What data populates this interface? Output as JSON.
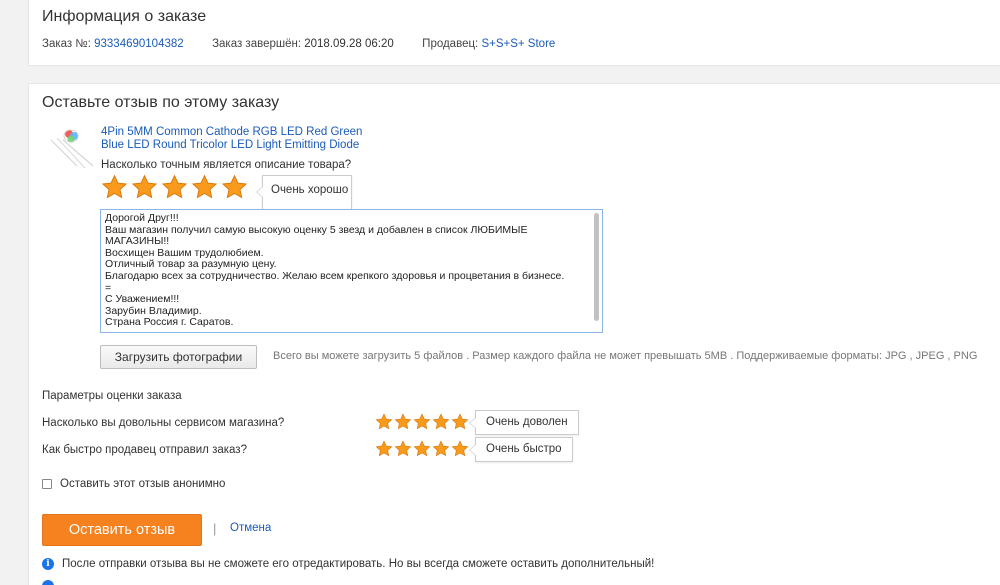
{
  "order_info": {
    "title": "Информация о заказе",
    "order_label": "Заказ №:",
    "order_number": "93334690104382",
    "completed_label": "Заказ завершён:",
    "completed_value": "2018.09.28 06:20",
    "seller_label": "Продавец:",
    "seller_name": "S+S+S+ Store"
  },
  "review": {
    "title": "Оставьте отзыв по этому заказу",
    "product_title": "4Pin 5MM Common Cathode RGB LED Red Green Blue LED Round Tricolor LED Light Emitting Diode",
    "accuracy_question": "Насколько точным является описание товара?",
    "accuracy_rating": 5,
    "accuracy_tooltip": "Очень хорошо",
    "text": "Дорогой Друг!!!\nВаш магазин получил самую высокую оценку 5 звезд и добавлен в список ЛЮБИМЫЕ МАГАЗИНЫ!!\nВосхищен Вашим трудолюбием.\nОтличный товар за разумную цену.\nБлагодарю всех за сотрудничество. Желаю всем крепкого здоровья и процветания в бизнесе.\n=\nС Уважением!!!\nЗарубин Владимир.\nСтрана Россия г. Саратов.",
    "upload_button": "Загрузить фотографии",
    "upload_note": "Всего вы можете загрузить 5 файлов . Размер каждого файла не может превышать 5MB . Поддерживаемые форматы: JPG , JPEG , PNG"
  },
  "params": {
    "title": "Параметры оценки заказа",
    "service_question": "Насколько вы довольны сервисом магазина?",
    "service_rating": 5,
    "service_tooltip": "Очень доволен",
    "shipping_question": "Как быстро продавец отправил заказ?",
    "shipping_rating": 5,
    "shipping_tooltip": "Очень быстро"
  },
  "anonymous_label": "Оставить этот отзыв анонимно",
  "submit_label": "Оставить отзыв",
  "separator": "|",
  "cancel_label": "Отмена",
  "info_text": "После отправки отзыва вы не сможете его отредактировать. Но вы всегда сможете оставить дополнительный!",
  "info_icon_glyph": "i",
  "colors": {
    "accent_orange": "#f5821f",
    "star_orange": "#f89a1c",
    "link_blue": "#1a5bb8",
    "info_blue": "#1a73e8"
  },
  "icons": {
    "star": "star-icon",
    "info": "info-icon",
    "checkbox": "checkbox-icon"
  }
}
